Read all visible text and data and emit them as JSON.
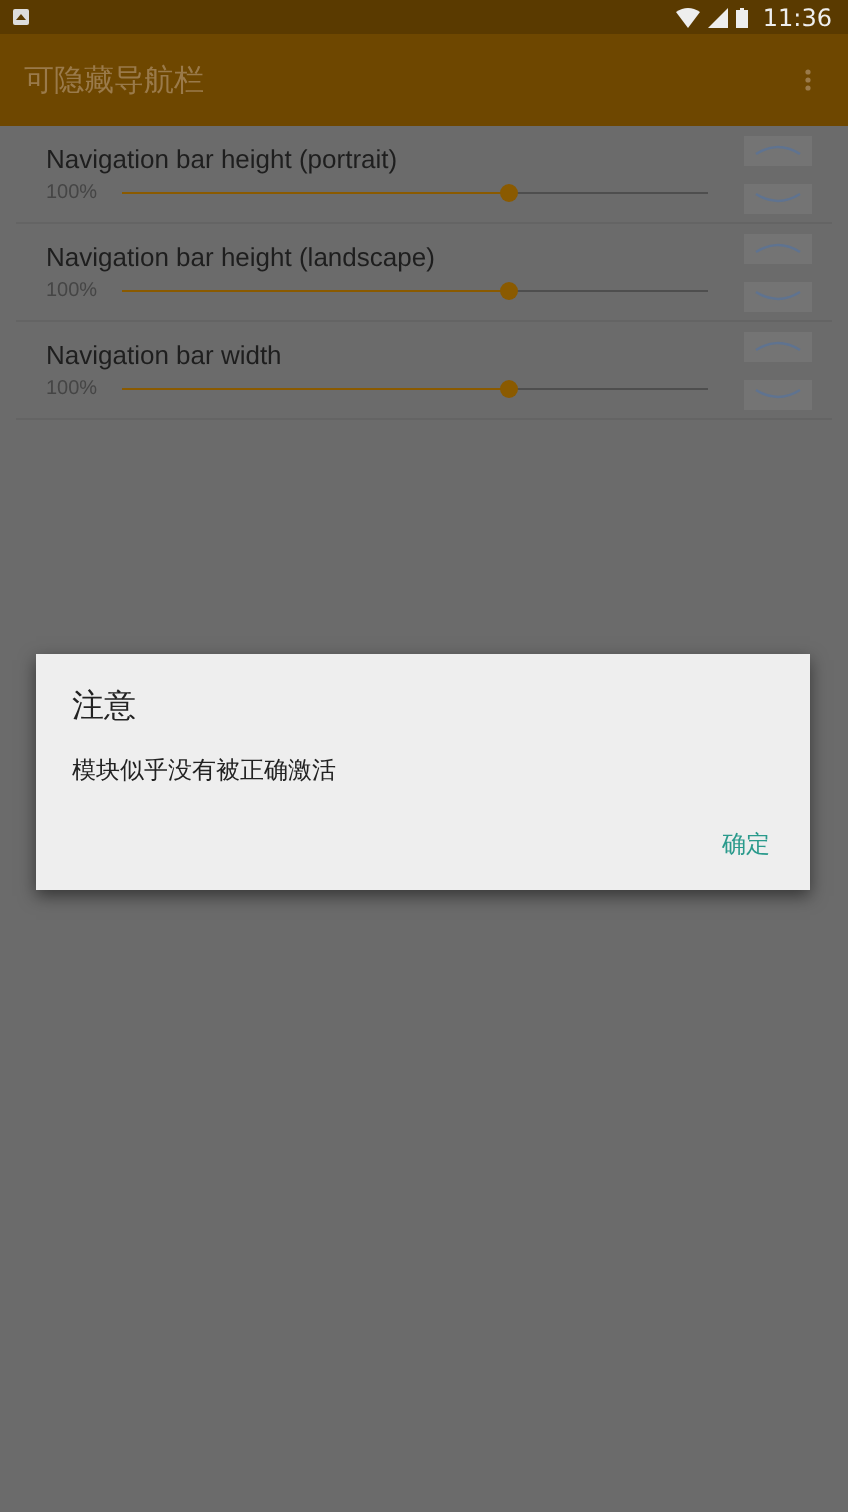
{
  "status_bar": {
    "time": "11:36"
  },
  "app_bar": {
    "title": "可隐藏导航栏"
  },
  "settings": [
    {
      "label": "Navigation bar height (portrait)",
      "value": "100%",
      "level": 0.66
    },
    {
      "label": "Navigation bar height (landscape)",
      "value": "100%",
      "level": 0.66
    },
    {
      "label": "Navigation bar width",
      "value": "100%",
      "level": 0.66
    }
  ],
  "dialog": {
    "title": "注意",
    "message": "模块似乎没有被正确激活",
    "buttons": [
      "确定"
    ]
  }
}
